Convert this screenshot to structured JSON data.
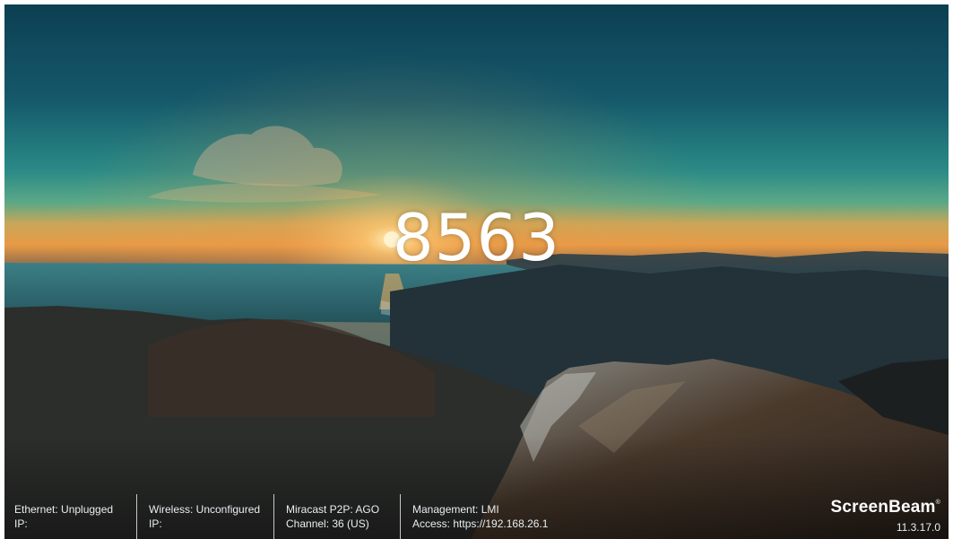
{
  "pin_code": "8563",
  "status": {
    "ethernet": {
      "line1": "Ethernet:  Unplugged",
      "line2": "IP:"
    },
    "wireless": {
      "line1": "Wireless:  Unconfigured",
      "line2": "IP:"
    },
    "miracast": {
      "line1": "Miracast P2P:  AGO",
      "line2": "Channel: 36 (US)"
    },
    "management": {
      "line1": "Management: LMI",
      "line2": "Access: https://192.168.26.1"
    }
  },
  "brand": {
    "name": "ScreenBeam",
    "trademark": "®",
    "version": "11.3.17.0"
  },
  "colors": {
    "sky_top": "#14586a",
    "sky_mid": "#2f9a8e",
    "horizon_glow": "#f0a24a",
    "sea": "#2f6f78",
    "mountains": "#1c1d1d",
    "text": "#ffffff"
  }
}
